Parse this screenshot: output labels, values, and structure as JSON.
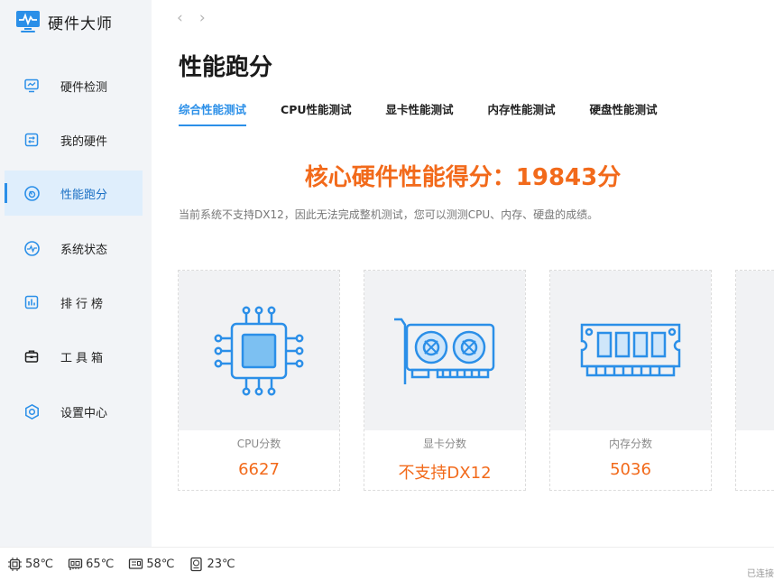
{
  "app": {
    "name": "硬件大师"
  },
  "sidebar": {
    "items": [
      {
        "label": "硬件检测",
        "icon": "monitor-icon"
      },
      {
        "label": "我的硬件",
        "icon": "hardware-icon"
      },
      {
        "label": "性能跑分",
        "icon": "speedometer-icon",
        "active": true
      },
      {
        "label": "系统状态",
        "icon": "pulse-icon"
      },
      {
        "label": "排行榜",
        "icon": "ranking-icon"
      },
      {
        "label": "工具箱",
        "icon": "toolbox-icon"
      },
      {
        "label": "设置中心",
        "icon": "settings-icon"
      }
    ]
  },
  "nav": {
    "back": "‹",
    "forward": "›"
  },
  "page": {
    "title": "性能跑分",
    "tabs": [
      "综合性能测试",
      "CPU性能测试",
      "显卡性能测试",
      "内存性能测试",
      "硬盘性能测试"
    ],
    "score_title": "核心硬件性能得分：19843分",
    "notice": "当前系统不支持DX12，因此无法完成整机测试，您可以测测CPU、内存、硬盘的成绩。"
  },
  "cards": [
    {
      "label": "CPU分数",
      "value": "6627",
      "icon": "cpu-icon"
    },
    {
      "label": "显卡分数",
      "value": "不支持DX12",
      "icon": "gpu-icon"
    },
    {
      "label": "内存分数",
      "value": "5036",
      "icon": "memory-icon"
    }
  ],
  "status": {
    "temps": [
      {
        "value": "58℃",
        "icon": "cpu-temp-icon"
      },
      {
        "value": "65℃",
        "icon": "gpu-temp-icon"
      },
      {
        "value": "58℃",
        "icon": "board-temp-icon"
      },
      {
        "value": "23℃",
        "icon": "disk-temp-icon"
      }
    ],
    "right_text": "已连接"
  },
  "colors": {
    "accent": "#2b8fe8",
    "score": "#f26a1b",
    "sidebar_bg": "#f2f4f7"
  }
}
